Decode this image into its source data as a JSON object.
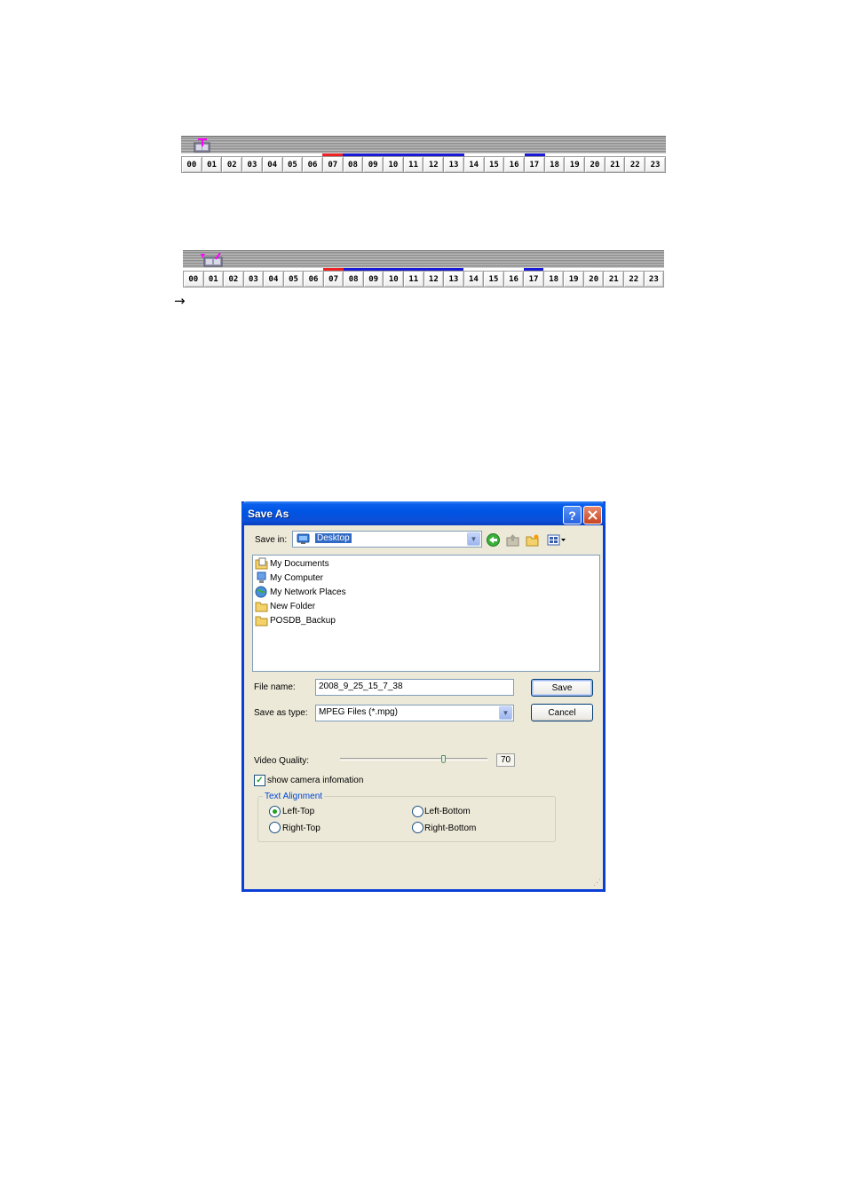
{
  "timeline_hours": [
    "00",
    "01",
    "02",
    "03",
    "04",
    "05",
    "06",
    "07",
    "08",
    "09",
    "10",
    "11",
    "12",
    "13",
    "14",
    "15",
    "16",
    "17",
    "18",
    "19",
    "20",
    "21",
    "22",
    "23"
  ],
  "timeline_colors": {
    "alarm": "#ee2222",
    "record": "#1a1ad6",
    "marker": "#ff00ff"
  },
  "arrow": "→",
  "dialog": {
    "title": "Save As",
    "help_button": "?",
    "close_button": "✕",
    "save_in_label": "Save in:",
    "save_in_value": "Desktop",
    "files": [
      "My Documents",
      "My Computer",
      "My Network Places",
      "New Folder",
      "POSDB_Backup"
    ],
    "file_name_label": "File name:",
    "file_name_value": "2008_9_25_15_7_38",
    "save_type_label": "Save as type:",
    "save_type_value": "MPEG Files (*.mpg)",
    "save_button": "Save",
    "cancel_button": "Cancel",
    "video_quality_label": "Video Quality:",
    "video_quality_value": "70",
    "show_camera_label": "show camera infomation",
    "text_alignment_legend": "Text Alignment",
    "align_left_top": "Left-Top",
    "align_left_bottom": "Left-Bottom",
    "align_right_top": "Right-Top",
    "align_right_bottom": "Right-Bottom",
    "title_bar_color": "#0054e3",
    "selection_color": "#316ac5",
    "check_color": "#21a121"
  }
}
